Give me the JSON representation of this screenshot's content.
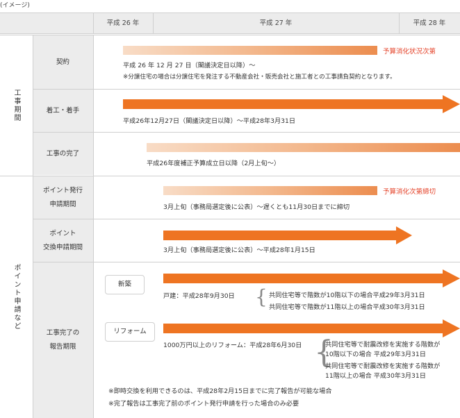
{
  "caption": "(イメージ)",
  "header": {
    "y26": "平成 26 年",
    "y27": "平成 27 年",
    "y28": "平成 28 年"
  },
  "groups": {
    "construction": "工事期間",
    "points": "ポイント申請など"
  },
  "rows": {
    "contract": {
      "label": "契約",
      "note_red": "予算消化状況次第",
      "line1": "平成 26 年 12 月 27 日（閣議決定日以降）～",
      "line2": "※分譲住宅の場合は分譲住宅を発注する不動産会社・販売会社と施工者との工事請負契約となります。"
    },
    "start": {
      "label": "着工・着手",
      "line1": "平成26年12月27日（閣議決定日以降）～平成28年3月31日"
    },
    "completion": {
      "label": "工事の完了",
      "line1": "平成26年度補正予算成立日以降（2月上旬～）"
    },
    "point_issue": {
      "label1": "ポイント発行",
      "label2": "申請期間",
      "note_red": "予算消化次第締切",
      "line1": "3月上旬（事務局選定後に公表）～遅くとも11月30日までに締切"
    },
    "point_exchange": {
      "label1": "ポイント",
      "label2": "交換申請期間",
      "line1": "3月上旬（事務局選定後に公表）～平成28年1月15日"
    },
    "report": {
      "label1": "工事完了の",
      "label2": "報告期限",
      "new_badge": "新築",
      "new_line": "戸建：平成28年9月30日",
      "new_opt1": "共同住宅等で階数が10階以下の場合平成29年3月31日",
      "new_opt2": "共同住宅等で階数が11階以上の場合平成30年3月31日",
      "reform_badge": "リフォーム",
      "reform_line": "1000万円以上のリフォーム：平成28年6月30日",
      "reform_opt1a": "共同住宅等で耐震改修を実施する階数が",
      "reform_opt1b": "10階以下の場合 平成29年3月31日",
      "reform_opt2a": "共同住宅等で耐震改修を実施する階数が",
      "reform_opt2b": "11階以上の場合 平成30年3月31日",
      "foot1": "※即時交換を利用できるのは、平成28年2月15日までに完了報告が可能な場合",
      "foot2": "※完了報告は工事完了前のポイント発行申請を行った場合のみ必要"
    }
  },
  "colors": {
    "arrow": "#ee7422",
    "red": "#e4432a",
    "header_bg": "#ececec"
  }
}
